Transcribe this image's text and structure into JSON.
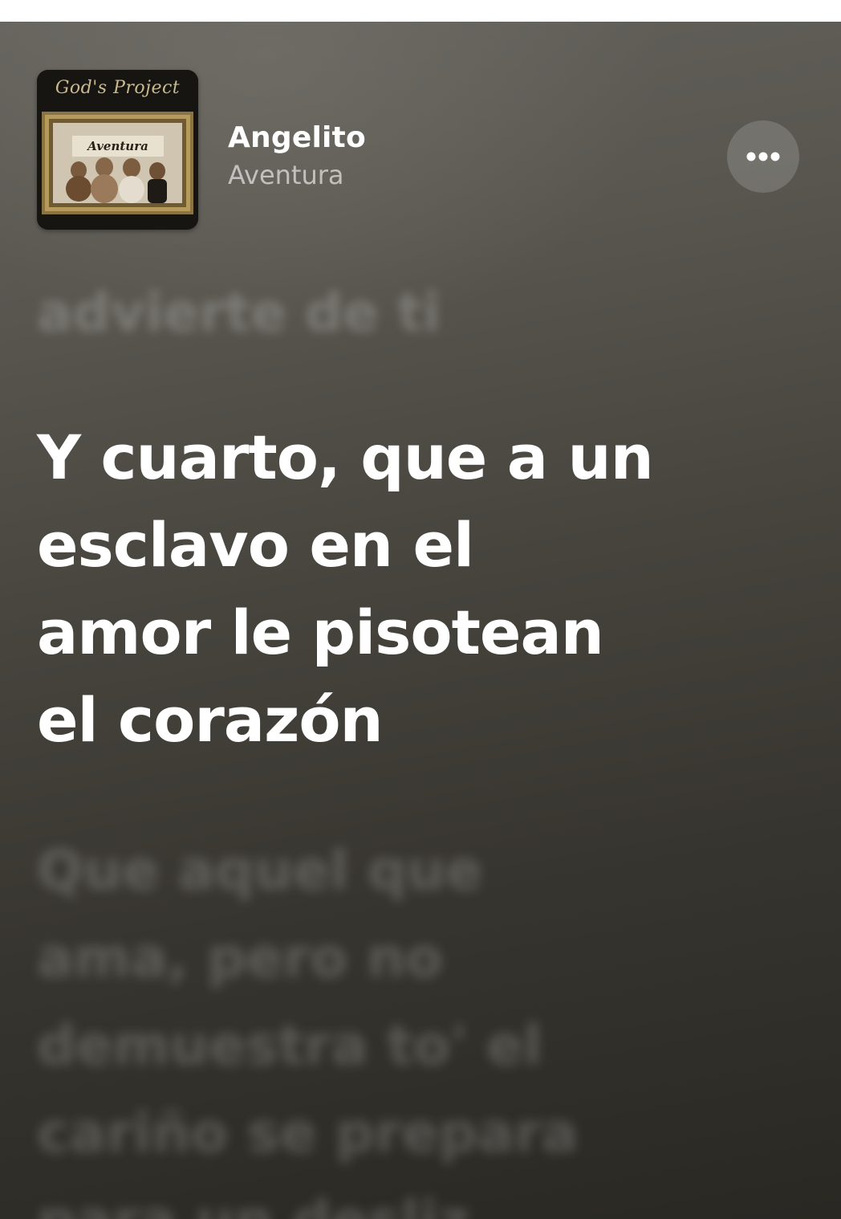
{
  "now_playing": {
    "title": "Angelito",
    "artist": "Aventura",
    "album_art": {
      "brand_text": "God's Project",
      "band_text": "Aventura"
    }
  },
  "more_button": {
    "icon": "ellipsis-icon"
  },
  "lyrics": {
    "previous": "advierte de ti",
    "current_lines": [
      "Y cuarto, que a un",
      "esclavo en el",
      "amor le pisotean",
      "el corazón"
    ],
    "next_lines": [
      "Que aquel que",
      "ama, pero no",
      "demuestra to' el",
      "cariño se prepara",
      "para un desliz"
    ]
  },
  "colors": {
    "background_top": "#64625c",
    "background_bottom": "#292823",
    "lyric_active": "#ffffff",
    "secondary_text": "rgba(255,255,255,0.6)"
  }
}
